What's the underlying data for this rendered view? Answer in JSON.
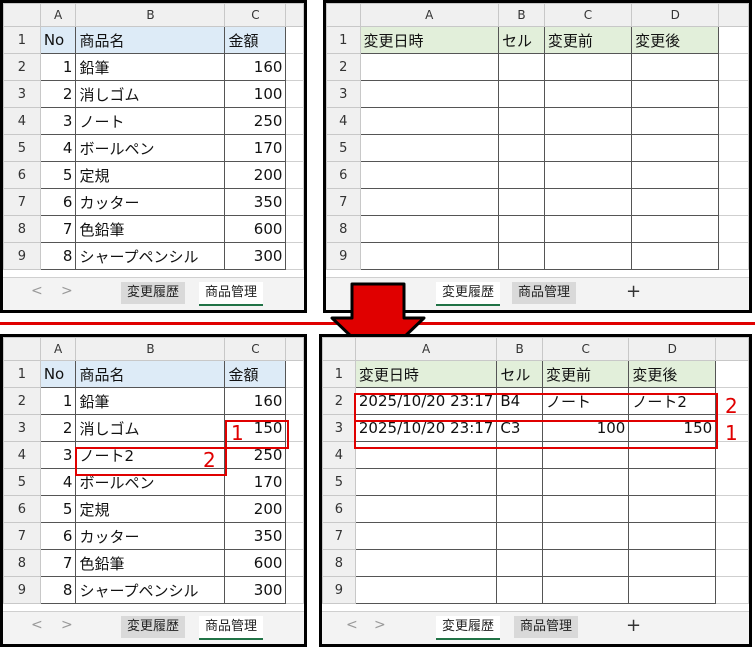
{
  "colors": {
    "accent_red": "#e00000",
    "header_blue": "#ddebf7",
    "header_green": "#e2efda",
    "tab_underline": "#217346"
  },
  "top_left": {
    "col_headers": [
      "A",
      "B",
      "C"
    ],
    "row_numbers": [
      "1",
      "2",
      "3",
      "4",
      "5",
      "6",
      "7",
      "8",
      "9"
    ],
    "header": [
      "No",
      "商品名",
      "金額"
    ],
    "rows": [
      [
        "1",
        "鉛筆",
        "160"
      ],
      [
        "2",
        "消しゴム",
        "100"
      ],
      [
        "3",
        "ノート",
        "250"
      ],
      [
        "4",
        "ボールペン",
        "170"
      ],
      [
        "5",
        "定規",
        "200"
      ],
      [
        "6",
        "カッター",
        "350"
      ],
      [
        "7",
        "色鉛筆",
        "600"
      ],
      [
        "8",
        "シャープペンシル",
        "300"
      ]
    ],
    "tabs": [
      "変更履歴",
      "商品管理"
    ]
  },
  "top_right": {
    "col_headers": [
      "A",
      "B",
      "C",
      "D"
    ],
    "row_numbers": [
      "1",
      "2",
      "3",
      "4",
      "5",
      "6",
      "7",
      "8",
      "9"
    ],
    "header": [
      "変更日時",
      "セル",
      "変更前",
      "変更後"
    ],
    "tabs": [
      "変更履歴",
      "商品管理",
      "+"
    ]
  },
  "bottom_left": {
    "col_headers": [
      "A",
      "B",
      "C"
    ],
    "row_numbers": [
      "1",
      "2",
      "3",
      "4",
      "5",
      "6",
      "7",
      "8",
      "9"
    ],
    "header": [
      "No",
      "商品名",
      "金額"
    ],
    "rows": [
      [
        "1",
        "鉛筆",
        "160"
      ],
      [
        "2",
        "消しゴム",
        "150"
      ],
      [
        "3",
        "ノート2",
        "250"
      ],
      [
        "4",
        "ボールペン",
        "170"
      ],
      [
        "5",
        "定規",
        "200"
      ],
      [
        "6",
        "カッター",
        "350"
      ],
      [
        "7",
        "色鉛筆",
        "600"
      ],
      [
        "8",
        "シャープペンシル",
        "300"
      ]
    ],
    "tabs": [
      "変更履歴",
      "商品管理"
    ],
    "markers": [
      "1",
      "2"
    ]
  },
  "bottom_right": {
    "col_headers": [
      "A",
      "B",
      "C",
      "D"
    ],
    "row_numbers": [
      "1",
      "2",
      "3",
      "4",
      "5",
      "6",
      "7",
      "8",
      "9"
    ],
    "header": [
      "変更日時",
      "セル",
      "変更前",
      "変更後"
    ],
    "rows": [
      [
        "2025/10/20 23:17",
        "B4",
        "ノート",
        "ノート2"
      ],
      [
        "2025/10/20 23:17",
        "C3",
        "100",
        "150"
      ]
    ],
    "tabs": [
      "変更履歴",
      "商品管理",
      "+"
    ],
    "markers": [
      "2",
      "1"
    ]
  },
  "nav": {
    "prev": "<",
    "next": ">"
  }
}
